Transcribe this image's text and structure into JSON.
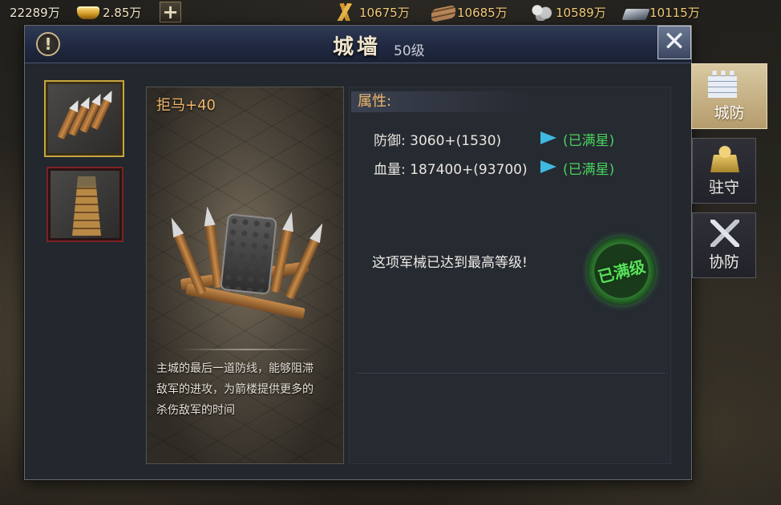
{
  "topbar": {
    "silver": "22289万",
    "gold": "2.85万",
    "resources": [
      {
        "icon": "wheat-icon",
        "value": "10675万"
      },
      {
        "icon": "wood-icon",
        "value": "10685万"
      },
      {
        "icon": "stone-icon",
        "value": "10589万"
      },
      {
        "icon": "iron-icon",
        "value": "10115万"
      }
    ]
  },
  "header": {
    "title": "城墙",
    "level": "50级",
    "info_icon": "!",
    "close_icon": "✕"
  },
  "card": {
    "title": "拒马+40",
    "description_lines": [
      "主城的最后一道防线，能够阻滞",
      "敌军的进攻，为箭楼提供更多的",
      "杀伤敌军的时间"
    ]
  },
  "attributes": {
    "heading": "属性:",
    "rows": [
      {
        "label": "防御:",
        "value": "3060+(1530)",
        "status": "(已满星)"
      },
      {
        "label": "血量:",
        "value": "187400+(93700)",
        "status": "(已满星)"
      }
    ],
    "max_message": "这项军械已达到最高等级!",
    "max_seal": "已满级"
  },
  "side_tabs": [
    {
      "label": "城防",
      "icon": "wall-icon",
      "active": true
    },
    {
      "label": "驻守",
      "icon": "soldier-icon",
      "active": false
    },
    {
      "label": "协防",
      "icon": "swords-icon",
      "active": false
    }
  ],
  "colors": {
    "accent_orange": "#f0b86a",
    "status_green": "#48d45b",
    "arrow_blue": "#3fb9e0",
    "header_blue": "#1f2840"
  }
}
